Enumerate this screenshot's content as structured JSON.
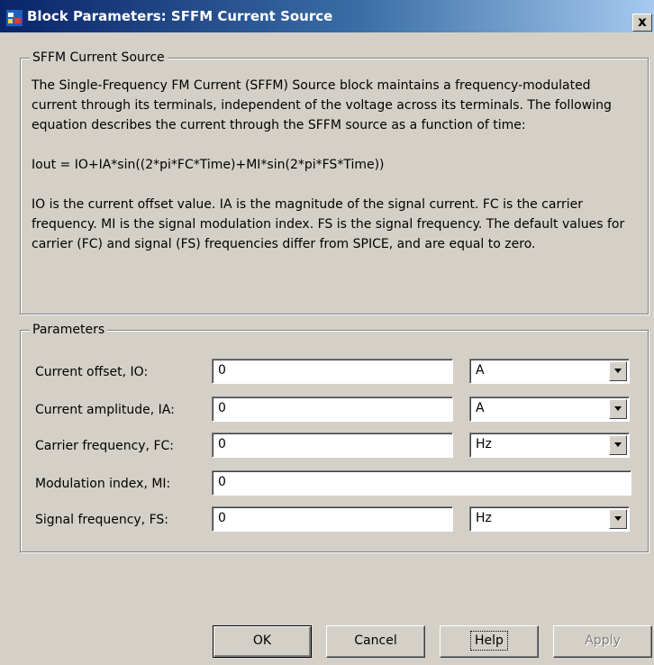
{
  "window": {
    "title": "Block Parameters: SFFM Current Source",
    "close_label": "x"
  },
  "description": {
    "legend": "SFFM Current Source",
    "paragraphs": [
      "The Single-Frequency FM Current (SFFM) Source block maintains a frequency-modulated current through its terminals, independent of the voltage across its terminals. The following equation describes the current through the SFFM source as a function of time:",
      "Iout = IO+IA*sin((2*pi*FC*Time)+MI*sin(2*pi*FS*Time))",
      "IO is the current offset value. IA is the magnitude of the signal current. FC is the carrier frequency. MI is the signal modulation index. FS is the signal frequency. The default values for carrier (FC) and signal (FS) frequencies differ from SPICE, and are equal to zero."
    ]
  },
  "parameters": {
    "legend": "Parameters",
    "rows": [
      {
        "label": "Current offset, IO:",
        "value": "0",
        "unit": "A"
      },
      {
        "label": "Current amplitude, IA:",
        "value": "0",
        "unit": "A"
      },
      {
        "label": "Carrier frequency, FC:",
        "value": "0",
        "unit": "Hz"
      },
      {
        "label": "Modulation index, MI:",
        "value": "0"
      },
      {
        "label": "Signal frequency, FS:",
        "value": "0",
        "unit": "Hz"
      }
    ]
  },
  "buttons": {
    "ok": "OK",
    "cancel": "Cancel",
    "help": "Help",
    "apply": "Apply"
  },
  "icons": {
    "app": "simulink-block-icon",
    "close": "close-icon",
    "dropdown": "chevron-down-icon"
  }
}
